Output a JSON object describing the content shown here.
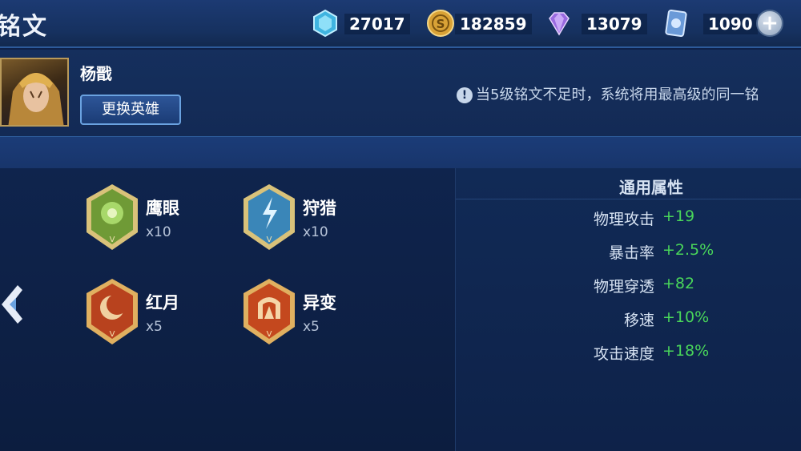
{
  "header": {
    "title": "铭文",
    "resources": [
      {
        "name": "diamond",
        "value": "27017",
        "color": "#5ad0f0"
      },
      {
        "name": "gold",
        "value": "182859",
        "color": "#e8b54a"
      },
      {
        "name": "crystal",
        "value": "13079",
        "color": "#b48af0"
      },
      {
        "name": "voucher",
        "value": "1090",
        "color": "#7ab0e8"
      }
    ]
  },
  "hero": {
    "name": "杨戬",
    "change_button": "更换英雄",
    "notice": "当5级铭文不足时，系统将用最高级的同一铭"
  },
  "runes": [
    {
      "name": "鹰眼",
      "count": "x10",
      "color": "green"
    },
    {
      "name": "狩猎",
      "count": "x10",
      "color": "blue"
    },
    {
      "name": "红月",
      "count": "x5",
      "color": "red"
    },
    {
      "name": "异变",
      "count": "x5",
      "color": "red"
    }
  ],
  "stats": {
    "title": "通用属性",
    "rows": [
      {
        "label": "物理攻击",
        "value": "+19"
      },
      {
        "label": "暴击率",
        "value": "+2.5%"
      },
      {
        "label": "物理穿透",
        "value": "+82"
      },
      {
        "label": "移速",
        "value": "+10%"
      },
      {
        "label": "攻击速度",
        "value": "+18%"
      }
    ]
  }
}
